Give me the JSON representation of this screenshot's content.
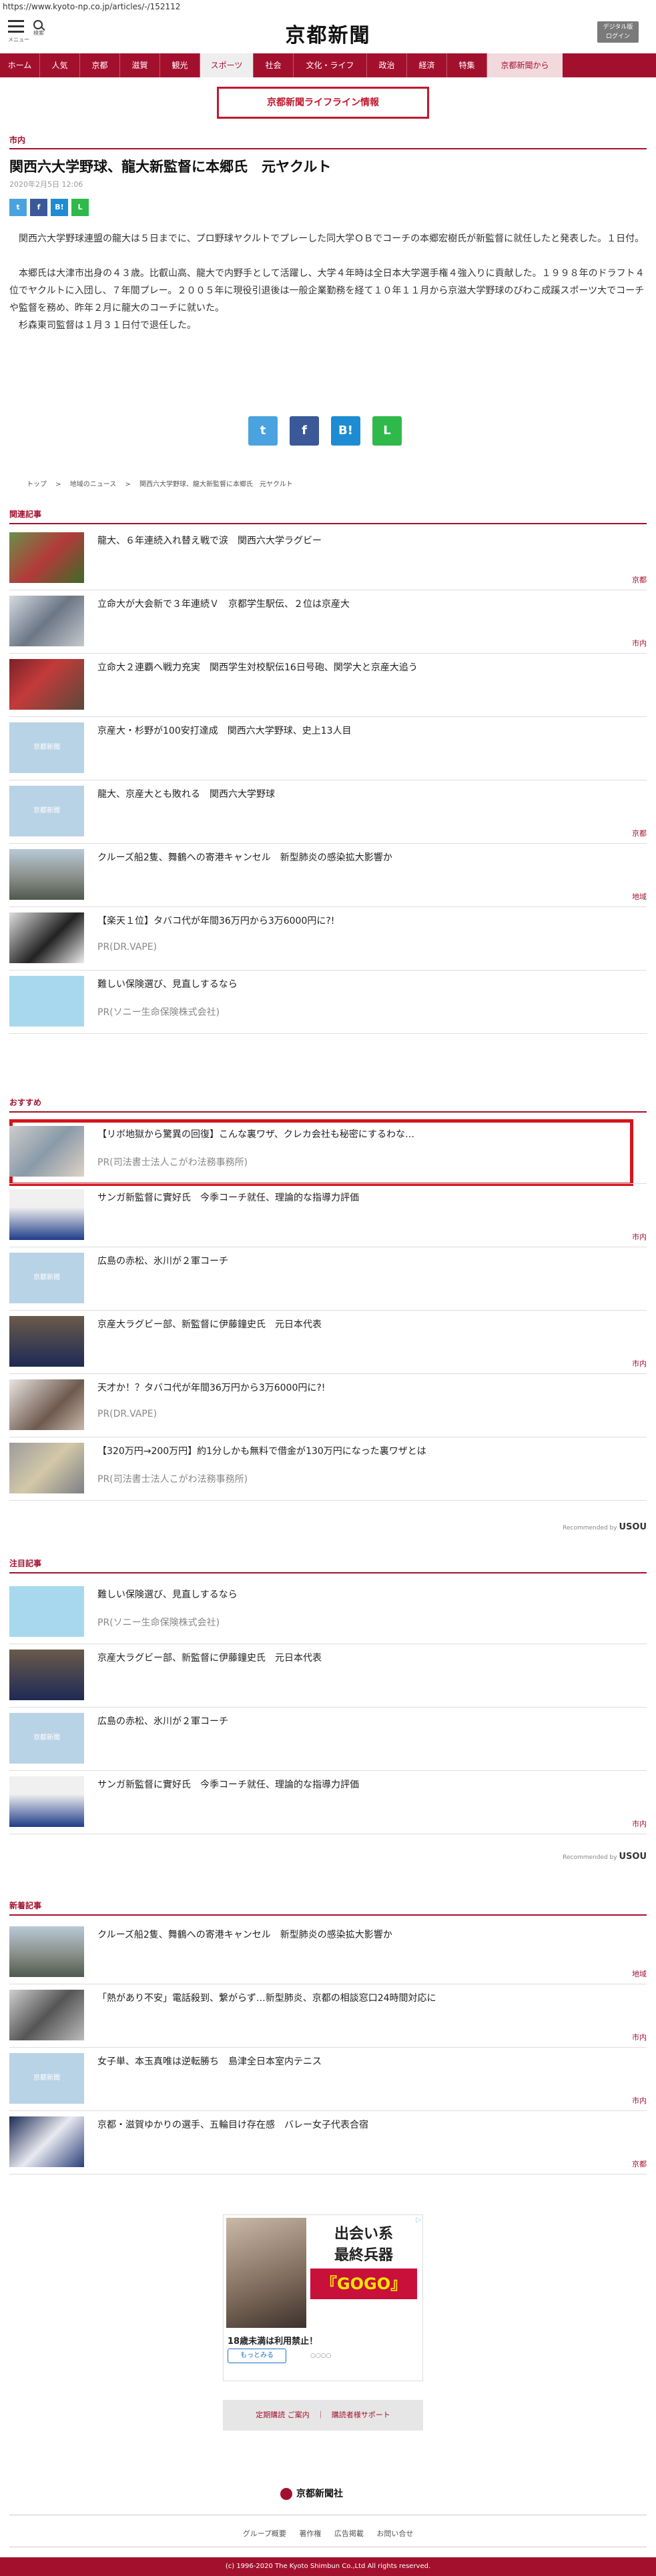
{
  "browser": {
    "url": "https://www.kyoto-np.co.jp/articles/-/152112"
  },
  "header": {
    "menu_label": "メニュー",
    "search_label": "検索",
    "logo": "京都新聞",
    "login_label_1": "デジタル版",
    "login_label_2": "ログイン"
  },
  "nav": {
    "items": [
      "ホーム",
      "人気",
      "京都",
      "滋賀",
      "観光",
      "スポーツ",
      "社会",
      "文化・ライフ",
      "政治",
      "経済",
      "特集",
      "京都新聞から"
    ],
    "active_index": 5
  },
  "live_info": "京都新聞ライフライン情報",
  "article": {
    "category": "市内",
    "title": "関西六大学野球、龍大新監督に本郷氏　元ヤクルト",
    "date": "2020年2月5日 12:06",
    "p1": "　関西六大学野球連盟の龍大は５日までに、プロ野球ヤクルトでプレーした同大学ＯＢでコーチの本郷宏樹氏が新監督に就任したと発表した。１日付。",
    "p2": "　本郷氏は大津市出身の４３歳。比叡山高、龍大で内野手として活躍し、大学４年時は全日本大学選手権４強入りに貢献した。１９９８年のドラフト４位でヤクルトに入団し、７年間プレー。２００５年に現役引退後は一般企業勤務を経て１０年１１月から京滋大学野球のびわこ成蹊スポーツ大でコーチや監督を務め、昨年２月に龍大のコーチに就いた。",
    "p3": "　杉森東司監督は１月３１日付で退任した。"
  },
  "share": {
    "twitter": "t",
    "facebook": "f",
    "hatena": "B!",
    "line": "L"
  },
  "breadcrumb": [
    "トップ",
    "地域のニュース",
    "関西六大学野球、龍大新監督に本郷氏　元ヤクルト"
  ],
  "related": {
    "title": "関連記事",
    "items": [
      {
        "title": "龍大、６年連続入れ替え戦で涙　関西六大学ラグビー",
        "cat": "京都",
        "thumb": "photo-rugby"
      },
      {
        "title": "立命大が大会新で３年連続Ｖ　京都学生駅伝、２位は京産大",
        "cat": "市内",
        "thumb": "photo-runner"
      },
      {
        "title": "立命大２連覇へ戦力充実　関西学生対校駅伝16日号砲、関学大と京産大追う",
        "cat": "",
        "thumb": "photo-runners-red"
      },
      {
        "title": "京産大・杉野が100安打達成　関西六大学野球、史上13人目",
        "cat": "",
        "thumb": "placeholder"
      },
      {
        "title": "龍大、京産大とも敗れる　関西六大学野球",
        "cat": "京都",
        "thumb": "placeholder"
      },
      {
        "title": "クルーズ船2隻、舞鶴への寄港キャンセル　新型肺炎の感染拡大影響か",
        "cat": "地域",
        "thumb": "photo-building"
      },
      {
        "title": "【楽天１位】タバコ代が年間36万円から3万6000円に?!",
        "pr": "PR(DR.VAPE)",
        "thumb": "photo-device"
      },
      {
        "title": "難しい保険選び、見直しするなら",
        "pr": "PR(ソニー生命保険株式会社)",
        "thumb": "photo-insurance"
      }
    ]
  },
  "recommend": {
    "title": "おすすめ",
    "items": [
      {
        "title": "【リボ地獄から驚異の回復】こんな裏ワザ、クレカ会社も秘密にするわな…",
        "pr": "PR(司法書士法人こがわ法務事務所)",
        "thumb": "photo-cards"
      },
      {
        "title": "サンガ新監督に實好氏　今季コーチ就任、理論的な指導力評価",
        "cat": "市内",
        "thumb": "photo-person"
      },
      {
        "title": "広島の赤松、氷川が２軍コーチ",
        "cat": "",
        "thumb": "placeholder"
      },
      {
        "title": "京産大ラグビー部、新監督に伊藤鐘史氏　元日本代表",
        "cat": "市内",
        "thumb": "photo-person2"
      },
      {
        "title": "天才か！？タバコ代が年間36万円から3万6000円に?!",
        "pr": "PR(DR.VAPE)",
        "thumb": "photo-woman"
      },
      {
        "title": "【320万円→200万円】約1分しかも無料で借金が130万円になった裏ワザとは",
        "pr": "PR(司法書士法人こがわ法務事務所)",
        "thumb": "photo-money"
      }
    ]
  },
  "attention": {
    "title": "注目記事",
    "items": [
      {
        "title": "難しい保険選び、見直しするなら",
        "pr": "PR(ソニー生命保険株式会社)",
        "thumb": "photo-insurance"
      },
      {
        "title": "京産大ラグビー部、新監督に伊藤鐘史氏　元日本代表",
        "cat": "",
        "thumb": "photo-person2"
      },
      {
        "title": "広島の赤松、氷川が２軍コーチ",
        "cat": "",
        "thumb": "placeholder"
      },
      {
        "title": "サンガ新監督に實好氏　今季コーチ就任、理論的な指導力評価",
        "cat": "市内",
        "thumb": "photo-person"
      }
    ]
  },
  "recommended_by": "Recommended by",
  "recommended_brand": "USOU",
  "latest": {
    "title": "新着記事",
    "items": [
      {
        "title": "クルーズ船2隻、舞鶴への寄港キャンセル　新型肺炎の感染拡大影響か",
        "cat": "地域",
        "thumb": "photo-building"
      },
      {
        "title": "「熱があり不安」電話殺到、繋がらず…新型肺炎、京都の相談窓口24時間対応に",
        "cat": "市内",
        "thumb": "photo-office"
      },
      {
        "title": "女子単、本玉真唯は逆転勝ち　島津全日本室内テニス",
        "cat": "市内",
        "thumb": "placeholder"
      },
      {
        "title": "京都・滋賀ゆかりの選手、五輪目け存在感　バレー女子代表合宿",
        "cat": "京都",
        "thumb": "photo-volley"
      }
    ]
  },
  "ad": {
    "line1": "出会い系",
    "line2": "最終兵器",
    "line3": "『GOGO』",
    "caption": "18歳未満は利用禁止！",
    "button": "もっとみる",
    "footer": "○○○○"
  },
  "subscribe": "定期購読 ご案内　｜　購読者様サポート",
  "footer": {
    "logo": "京都新聞社",
    "links": [
      "グループ概要",
      "著作権",
      "広告掲載",
      "お問い合せ"
    ],
    "copyright": "(c) 1996-2020 The Kyoto Shimbun Co.,Ltd All rights reserved."
  }
}
